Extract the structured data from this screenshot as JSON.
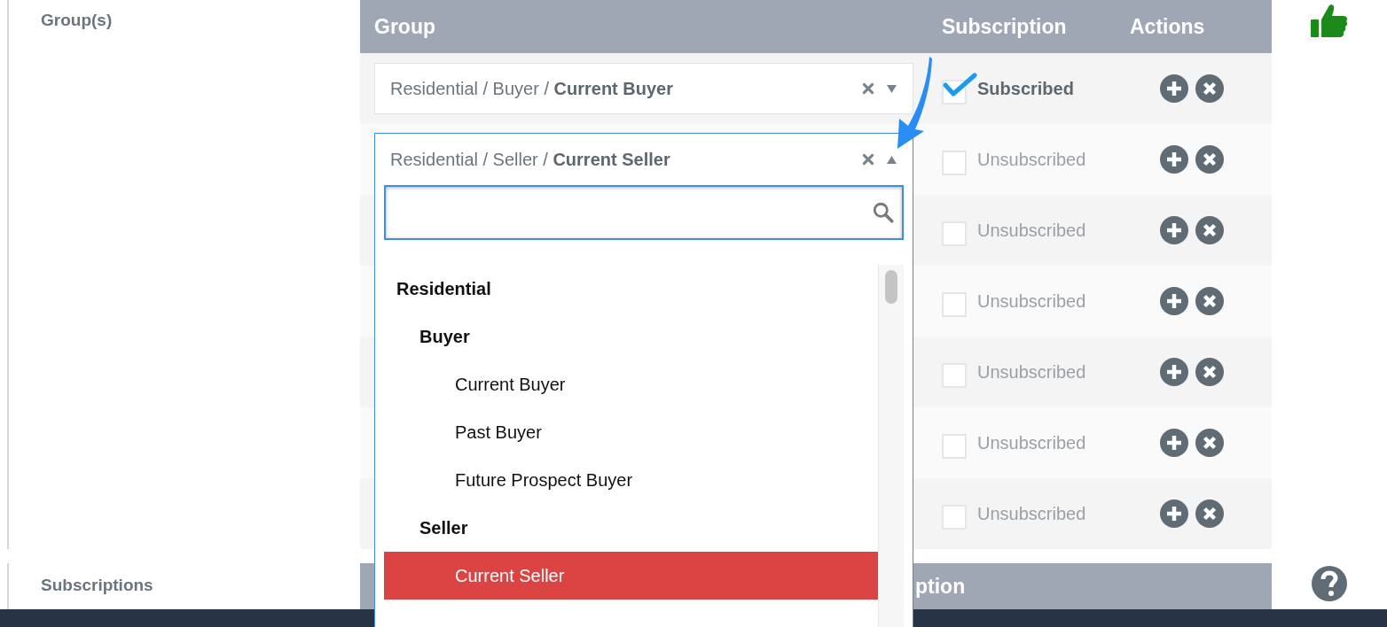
{
  "groups_label": "Group(s)",
  "table": {
    "columns": [
      "Group",
      "Subscription",
      "Actions"
    ],
    "rows": [
      {
        "group": "Residential / Buyer / **Current Buyer**",
        "expanded": false,
        "checked": true,
        "status": "Subscribed"
      },
      {
        "group": "Residential / Seller / **Current Seller**",
        "expanded": true,
        "checked": false,
        "status": "Unsubscribed"
      },
      {
        "checked": false,
        "status": "Unsubscribed"
      },
      {
        "checked": false,
        "status": "Unsubscribed"
      },
      {
        "checked": false,
        "status": "Unsubscribed"
      },
      {
        "checked": false,
        "status": "Unsubscribed"
      },
      {
        "checked": false,
        "status": "Unsubscribed"
      }
    ]
  },
  "dropdown": {
    "options": [
      {
        "label": "Residential",
        "children": [
          {
            "label": "Buyer",
            "children": [
              {
                "label": "Current Buyer",
                "selected": false
              },
              {
                "label": "Past Buyer",
                "selected": false
              },
              {
                "label": "Future Prospect Buyer",
                "selected": false
              }
            ]
          },
          {
            "label": "Seller",
            "children": [
              {
                "label": "Current Seller",
                "selected": true
              }
            ]
          }
        ]
      }
    ]
  },
  "subscriptions_label": "Subscriptions",
  "subscriptions_table": {
    "columns": [
      "ption"
    ]
  }
}
